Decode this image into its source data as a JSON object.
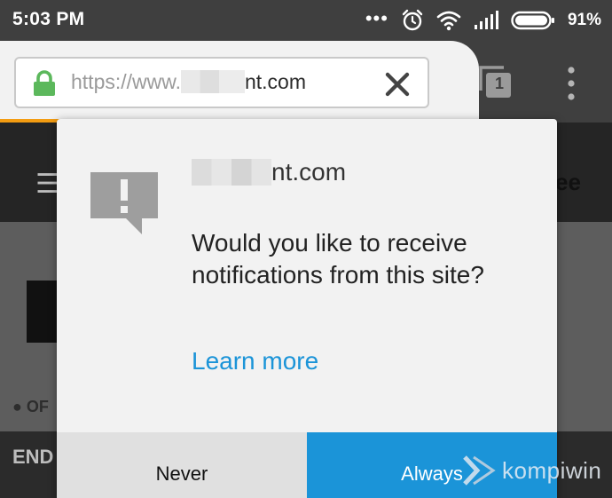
{
  "status_bar": {
    "time": "5:03 PM",
    "dots": "•••",
    "battery_percent": "91%"
  },
  "browser": {
    "url_prefix": "https://www.",
    "url_suffix": "nt.com",
    "lock_color": "#5cb85c",
    "accent_color": "#f39c12",
    "tab_count": "1"
  },
  "background_page": {
    "menu_glyph": "☰",
    "status_text": "● OF",
    "bottom_left_text": "END",
    "bottom_right_text": "ee"
  },
  "dialog": {
    "site_suffix": "nt.com",
    "question": "Would you like to receive notifications from this site?",
    "learn_more": "Learn more",
    "never_label": "Never",
    "always_label": "Always",
    "accent_color": "#1b94d8"
  },
  "watermark": {
    "text": "kompiwin"
  }
}
